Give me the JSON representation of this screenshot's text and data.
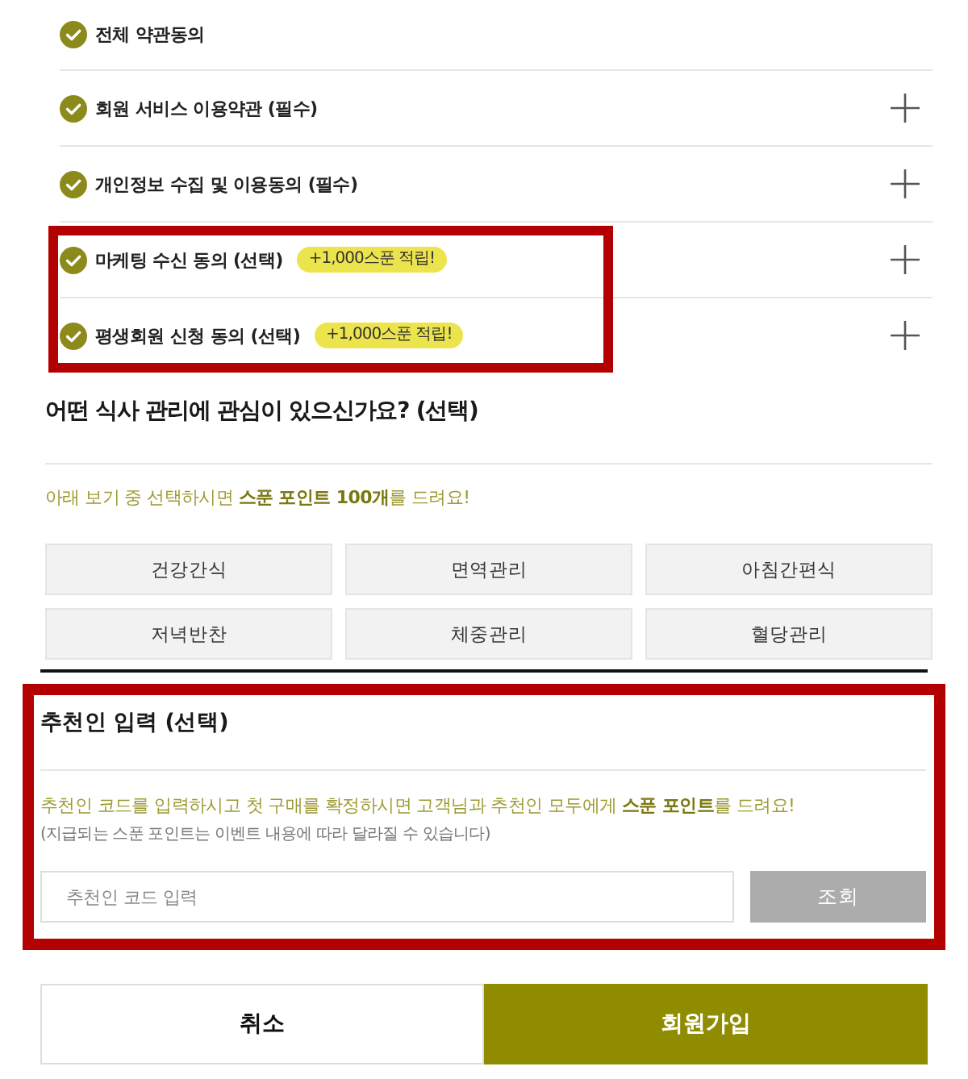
{
  "agreements": [
    {
      "kind": "all",
      "label": "전체 약관동의",
      "checked": true,
      "highlighted": false
    },
    {
      "kind": "term",
      "label": "회원 서비스 이용약관 (필수)",
      "checked": true,
      "expanded": false,
      "highlighted": false
    },
    {
      "kind": "term",
      "label": "개인정보 수집 및 이용동의 (필수)",
      "checked": true,
      "expanded": false,
      "highlighted": false
    },
    {
      "kind": "term",
      "label": "마케팅 수신 동의 (선택)",
      "badge": "+1,000스푼 적립!",
      "checked": true,
      "expanded": false,
      "highlighted": true
    },
    {
      "kind": "term",
      "label": "평생회원 신청 동의 (선택)",
      "badge": "+1,000스푼 적립!",
      "checked": true,
      "expanded": false,
      "highlighted": true
    }
  ],
  "interests": {
    "title": "어떤 식사 관리에 관심이 있으신가요? (선택)",
    "notice": "아래 보기 중 선택하시면 **스푼 포인트 100개**를 드려요!",
    "options": [
      {
        "label": "건강간식",
        "selected": false
      },
      {
        "label": "면역관리",
        "selected": false
      },
      {
        "label": "아침간편식",
        "selected": false
      },
      {
        "label": "저녁반찬",
        "selected": false
      },
      {
        "label": "체중관리",
        "selected": false
      },
      {
        "label": "혈당관리",
        "selected": false
      }
    ]
  },
  "referral": {
    "highlighted": true,
    "title": "추천인 입력 (선택)",
    "notice": "추천인 코드를 입력하시고 첫 구매를 확정하시면 고객님과 추천인 모두에게 **스푼 포인트**를 드려요!",
    "note": "(지급되는 스푼 포인트는 이벤트 내용에 따라 달라질 수 있습니다)",
    "input": {
      "placeholder": "추천인 코드 입력"
    },
    "lookup_button": {
      "label": "조회",
      "disabled": true
    }
  },
  "actions": [
    {
      "kind": "secondary",
      "label": "취소"
    },
    {
      "kind": "primary",
      "label": "회원가입"
    }
  ]
}
